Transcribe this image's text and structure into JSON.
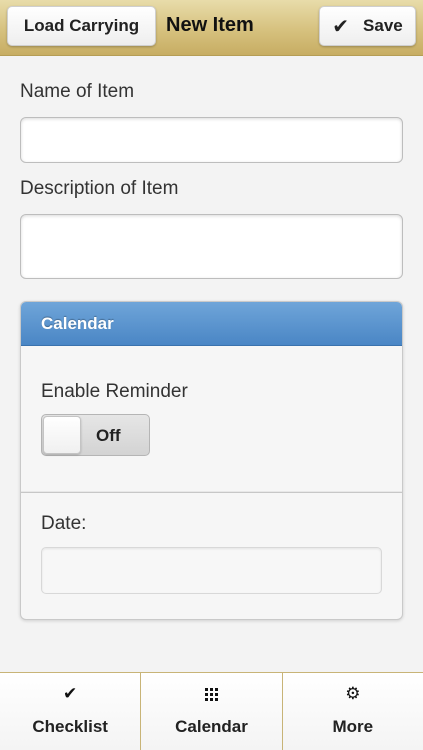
{
  "header": {
    "back_label": "Load Carrying",
    "title": "New Item",
    "save_label": "Save",
    "save_icon": "checkmark-icon"
  },
  "form": {
    "name_label": "Name of Item",
    "name_value": "",
    "description_label": "Description of Item",
    "description_value": ""
  },
  "calendar_section": {
    "heading": "Calendar",
    "reminder_label": "Enable Reminder",
    "reminder_state": "Off",
    "date_label": "Date:",
    "date_value": ""
  },
  "navbar": {
    "items": [
      {
        "label": "Checklist",
        "icon": "checkmark-icon"
      },
      {
        "label": "Calendar",
        "icon": "grid-icon"
      },
      {
        "label": "More",
        "icon": "gear-icon"
      }
    ]
  },
  "colors": {
    "header_gold": "#d6c17e",
    "section_blue": "#4a86c5"
  }
}
